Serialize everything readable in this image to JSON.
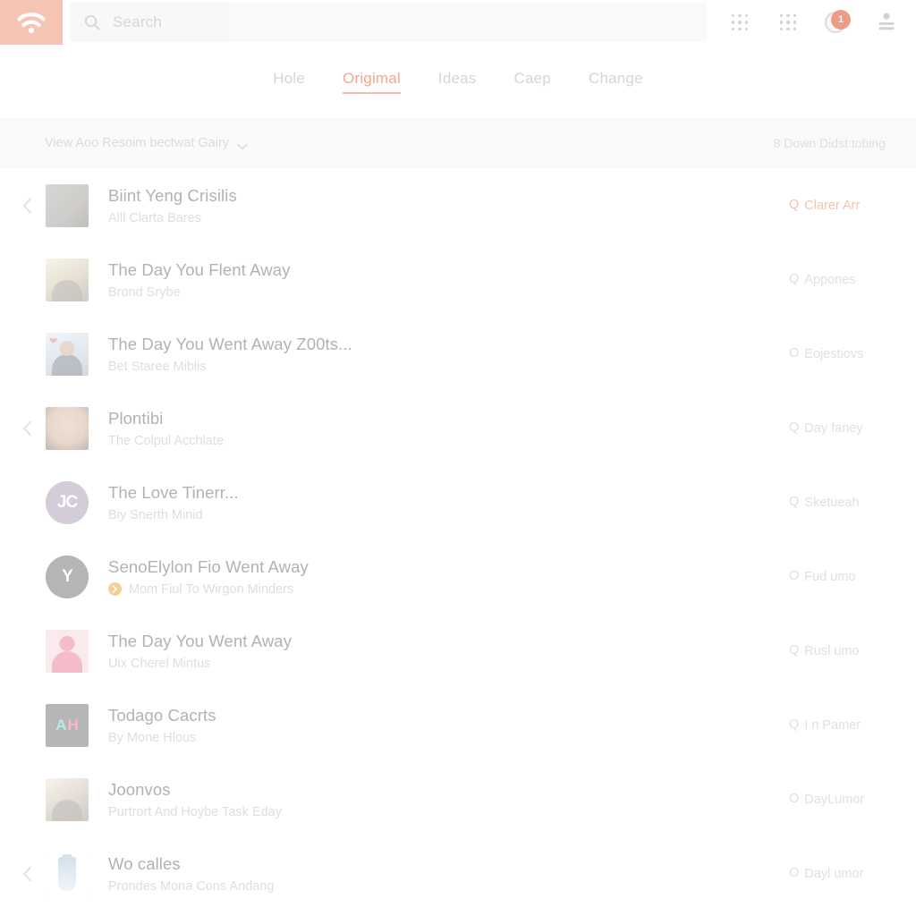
{
  "theme": {
    "accent": "#ef7f4e",
    "accent_soft": "#f0a184",
    "badge_red": "#e8593a",
    "badge_orange": "#f0a63c",
    "text_primary": "#8d8d8d",
    "text_muted": "#cfcfcf",
    "bar_bg": "#f7f7f7"
  },
  "topbar": {
    "logo_icon": "wifi-icon",
    "search": {
      "icon": "search-icon",
      "placeholder": "Search",
      "value": ""
    },
    "icons": [
      {
        "name": "apps-grid-icon",
        "label": ""
      },
      {
        "name": "apps-grid-squares-icon",
        "label": ""
      }
    ],
    "notification": {
      "icon": "notification-badge-icon",
      "count": "1"
    },
    "account": {
      "icon": "person-icon",
      "label": ""
    }
  },
  "tabs": [
    {
      "label": "Hole",
      "active": false
    },
    {
      "label": "Origimal",
      "active": true
    },
    {
      "label": "Ideas",
      "active": false
    },
    {
      "label": "Caep",
      "active": false
    },
    {
      "label": "Change",
      "active": false
    }
  ],
  "filterbar": {
    "left_label": "View Aoo Resoim bectwat Gairy",
    "left_icon": "chevron-down-icon",
    "right_label": "8 Down Didst:tobing"
  },
  "list": [
    {
      "chevron": true,
      "title": "Biint Yeng Crisilis",
      "subtitle": "Alll Clarta Bares",
      "sub_badge": false,
      "action_glyph": "Q",
      "action": "Clarer Arr",
      "action_accent": true,
      "thumb": {
        "kind": "photo-dark",
        "bg": "#8e8a86",
        "initials": ""
      }
    },
    {
      "chevron": false,
      "title": "The Day You Flent Away",
      "subtitle": "Brond Srybe",
      "sub_badge": false,
      "action_glyph": "Q",
      "action": "Appones",
      "action_accent": false,
      "thumb": {
        "kind": "photo-sepia",
        "bg": "#cbbb9c",
        "initials": ""
      }
    },
    {
      "chevron": false,
      "title": "The Day You Went Away Z00ts...",
      "subtitle": "Bet Staree Miblis",
      "sub_badge": false,
      "action_glyph": "O",
      "action": "Eojestiovs",
      "action_accent": false,
      "thumb": {
        "kind": "photo-heart",
        "bg": "#b9cedd",
        "initials": ""
      }
    },
    {
      "chevron": true,
      "title": "Plontibi",
      "subtitle": "The Colpul Acchlate",
      "sub_badge": false,
      "action_glyph": "Q",
      "action": "Day faney",
      "action_accent": false,
      "thumb": {
        "kind": "photo-face",
        "bg": "#c9a489",
        "initials": ""
      }
    },
    {
      "chevron": false,
      "title": "The Love Tinerr...",
      "subtitle": "Biy Snerth Minid",
      "sub_badge": false,
      "action_glyph": "Q",
      "action": "Sketueah",
      "action_accent": false,
      "thumb": {
        "kind": "avatar-initials",
        "bg": "#9b8ba6",
        "initials": "JC"
      }
    },
    {
      "chevron": false,
      "title": "SenoElylon Fio Went Away",
      "subtitle": "Mom Fiul To Wirgon Minders",
      "sub_badge": true,
      "action_glyph": "O",
      "action": "Fud umo",
      "action_accent": false,
      "thumb": {
        "kind": "avatar-initials",
        "bg": "#55504c",
        "initials": "Y"
      }
    },
    {
      "chevron": false,
      "title": "The Day You Went Away",
      "subtitle": "Uix Cherel Mintus",
      "sub_badge": false,
      "action_glyph": "Q",
      "action": "Rusl umo",
      "action_accent": false,
      "thumb": {
        "kind": "person-silhouette",
        "bg": "#f0cfd6",
        "initials": ""
      }
    },
    {
      "chevron": false,
      "title": "Todago Cacrts",
      "subtitle": "By Mone Hlous",
      "sub_badge": false,
      "action_glyph": "Q",
      "action": "I n Pamer",
      "action_accent": false,
      "thumb": {
        "kind": "letters-ah",
        "bg": "#4e5457",
        "initials": "AH"
      }
    },
    {
      "chevron": false,
      "title": "Joonvos",
      "subtitle": "Purtrort And Hoybe Task Eday",
      "sub_badge": false,
      "action_glyph": "O",
      "action": "DayLumor",
      "action_accent": false,
      "thumb": {
        "kind": "photo-sepia",
        "bg": "#c3b2a2",
        "initials": ""
      }
    },
    {
      "chevron": true,
      "title": "Wo calles",
      "subtitle": "Prondes Mona Cons Andang",
      "sub_badge": false,
      "action_glyph": "O",
      "action": "Dayl umor",
      "action_accent": false,
      "thumb": {
        "kind": "bottle",
        "bg": "#ffffff",
        "initials": ""
      }
    }
  ]
}
